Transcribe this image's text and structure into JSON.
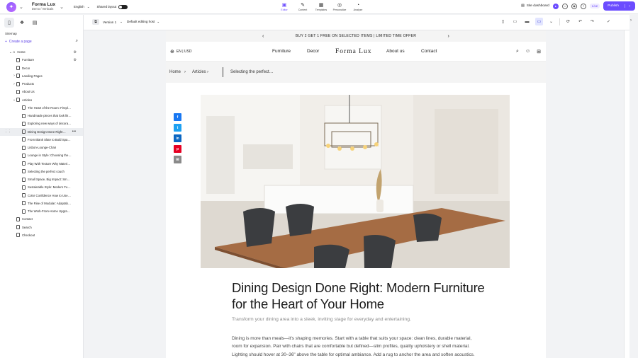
{
  "topbar": {
    "site_name": "Forma Lux",
    "site_sub": "Demo / Verticals",
    "language": "English",
    "shared_layout": "Shared layout",
    "modes": [
      {
        "label": "Editor",
        "icon": "editor-icon"
      },
      {
        "label": "Content",
        "icon": "content-icon"
      },
      {
        "label": "Templates",
        "icon": "templates-icon"
      },
      {
        "label": "Personalize",
        "icon": "personalize-icon"
      },
      {
        "label": "Analyze",
        "icon": "analyze-icon"
      }
    ],
    "site_dashboard": "Site dashboard",
    "live": "Live",
    "publish": "Publish"
  },
  "sidebar": {
    "title": "Sitemap",
    "create_page": "Create a page",
    "items": [
      {
        "label": "Home",
        "level": 0,
        "arrow": "⌄",
        "home": true,
        "settings": true
      },
      {
        "label": "Furniture",
        "level": 1,
        "settings": true
      },
      {
        "label": "Decor",
        "level": 1
      },
      {
        "label": "Landing Pages",
        "level": 1,
        "arrow": "›"
      },
      {
        "label": "Products",
        "level": 1,
        "arrow": "›"
      },
      {
        "label": "About Us",
        "level": 1
      },
      {
        "label": "Articles",
        "level": 1,
        "arrow": "⌄"
      },
      {
        "label": "The Heart of the Room: Fireplace…",
        "level": 2
      },
      {
        "label": "Handmade pieces that look like…",
        "level": 2
      },
      {
        "label": "Exploring new ways of decorating…",
        "level": 2
      },
      {
        "label": "Dining Design Done Right…",
        "level": 2,
        "selected": true
      },
      {
        "label": "From Blank Slate to Bold Space…",
        "level": 2
      },
      {
        "label": "Lisbon-Lounge-Chair",
        "level": 2
      },
      {
        "label": "Lounge in Style: Choosing the…",
        "level": 2
      },
      {
        "label": "Play With Texture Why Materials…",
        "level": 2
      },
      {
        "label": "Selecting the perfect couch",
        "level": 2
      },
      {
        "label": "Small Space, Big Impact: Smart…",
        "level": 2
      },
      {
        "label": "Sustainable Style: Modern Furniture…",
        "level": 2
      },
      {
        "label": "Color Confidence How to Use…",
        "level": 2
      },
      {
        "label": "The Rise of Modular: Adaptable…",
        "level": 2
      },
      {
        "label": "The Work-From-Home Upgrade…",
        "level": 2
      },
      {
        "label": "Contact",
        "level": 1
      },
      {
        "label": "Search",
        "level": 1
      },
      {
        "label": "Checkout",
        "level": 1
      }
    ]
  },
  "canvas": {
    "version": "Version 1",
    "host": "Default editing host"
  },
  "site": {
    "promo": "BUY 2 GET 1 FREE ON SELECTED ITEMS | LIMITED TIME OFFER",
    "locale": "EN | USD",
    "nav": [
      "Furniture",
      "Decor",
      "About us",
      "Contact"
    ],
    "brand": "Forma Lux",
    "breadcrumb": {
      "home": "Home",
      "articles": "Articles",
      "current": "Selecting the perfect…"
    },
    "share": [
      {
        "label": "f",
        "color": "#1877f2",
        "icon": "facebook-icon"
      },
      {
        "label": "t",
        "color": "#1da1f2",
        "icon": "twitter-icon"
      },
      {
        "label": "in",
        "color": "#0a66c2",
        "icon": "linkedin-icon"
      },
      {
        "label": "p",
        "color": "#e60023",
        "icon": "pinterest-icon"
      },
      {
        "label": "✉",
        "color": "#8a8a8a",
        "icon": "email-icon"
      }
    ],
    "title": "Dining Design Done Right: Modern Furniture for the Heart of Your Home",
    "subtitle": "Transform your dining area into a sleek, inviting stage for everyday and entertaining.",
    "body": "Dining is more than meals—it's shaping memories. Start with a table that suits your space: clean lines, durable material, room for expansion. Pair with chairs that are comfortable but defined—slim profiles, quality upholstery or shell material. Lighting should hover at 30–36\" above the table for optimal ambiance. Add a rug to anchor the area and soften acoustics. For accessories, keep it minimal—a sculptural bowl, a single vase, a piece of art—but meaningful. The goal"
  }
}
